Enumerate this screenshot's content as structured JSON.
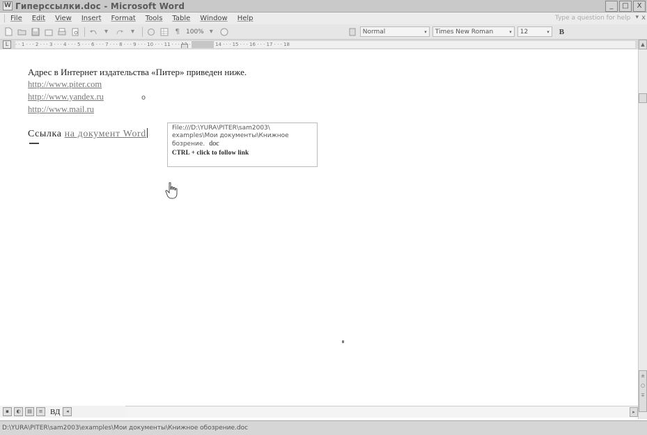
{
  "window": {
    "title": "Гиперссылки.doc - Microsoft Word",
    "controls": [
      "_",
      "□",
      "X"
    ]
  },
  "menu": {
    "items": [
      "File",
      "Edit",
      "View",
      "Insert",
      "Format",
      "Tools",
      "Table",
      "Window",
      "Help"
    ],
    "help_placeholder": "Type a question for help",
    "help_arrow": "▾",
    "close": "x"
  },
  "toolbar": {
    "zoom": "100%",
    "style": "Normal",
    "font": "Times New Roman",
    "size": "12",
    "bold": "B"
  },
  "ruler": {
    "tab_selector": "L",
    "marks": "· · 1 · · · 2 · · · 3 · · · 4 · · · 5 · · · 6 · · · 7 · · · 8 · · · 9 · · · 10 · · · 11 · · · 12 · · · 13 · · · 14 · · · 15 · · · 16 · · · 17 · · · 18"
  },
  "document": {
    "line1": "Адрес в Интернет издательства «Питер» приведен ниже.",
    "link1": "http://www.piter.com",
    "link2": "http://www.yandex.ru",
    "link3": "http://www.mail.ru",
    "bullet": "o",
    "line5_text": "Ссылка ",
    "line5_link": "на документ Word"
  },
  "tooltip": {
    "path1": "File:///D:\\YURA\\PITER\\sam2003\\",
    "path2": "examples\\Мои документы\\Книжное",
    "path3": "бозрение.",
    "ext": "doc",
    "hint": "CTRL + click to follow link"
  },
  "viewbar": {
    "label": "ВД"
  },
  "statusbar": {
    "path": "D:\\YURA\\PITER\\sam2003\\examples\\Мои документы\\Книжное обозрение.doc"
  }
}
